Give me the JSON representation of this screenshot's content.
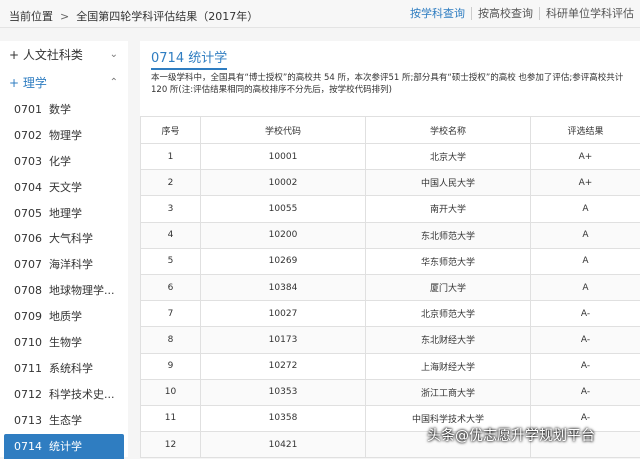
{
  "breadcrumb": {
    "current": "当前位置",
    "page": "全国第四轮学科评估结果（2017年）"
  },
  "top_links": [
    "按学科查询",
    "按高校查询",
    "科研单位学科评估"
  ],
  "sidebar": {
    "cat1": "人文社科类",
    "cat2": "理学",
    "items": [
      {
        "code": "0701",
        "name": "数学"
      },
      {
        "code": "0702",
        "name": "物理学"
      },
      {
        "code": "0703",
        "name": "化学"
      },
      {
        "code": "0704",
        "name": "天文学"
      },
      {
        "code": "0705",
        "name": "地理学"
      },
      {
        "code": "0706",
        "name": "大气科学"
      },
      {
        "code": "0707",
        "name": "海洋科学"
      },
      {
        "code": "0708",
        "name": "地球物理学..."
      },
      {
        "code": "0709",
        "name": "地质学"
      },
      {
        "code": "0710",
        "name": "生物学"
      },
      {
        "code": "0711",
        "name": "系统科学"
      },
      {
        "code": "0712",
        "name": "科学技术史..."
      },
      {
        "code": "0713",
        "name": "生态学"
      },
      {
        "code": "0714",
        "name": "统计学"
      }
    ]
  },
  "main": {
    "title": "0714 统计学",
    "description": "本一级学科中，全国具有“博士授权”的高校共 54 所，本次参评51 所;部分具有“硕士授权”的高校 也参加了评估;参评高校共计 120 所(注:评估结果相同的高校排序不分先后，按学校代码排列)",
    "columns": [
      "序号",
      "学校代码",
      "学校名称",
      "评选结果"
    ],
    "rows": [
      [
        "1",
        "10001",
        "北京大学",
        "A+"
      ],
      [
        "2",
        "10002",
        "中国人民大学",
        "A+"
      ],
      [
        "3",
        "10055",
        "南开大学",
        "A"
      ],
      [
        "4",
        "10200",
        "东北师范大学",
        "A"
      ],
      [
        "5",
        "10269",
        "华东师范大学",
        "A"
      ],
      [
        "6",
        "10384",
        "厦门大学",
        "A"
      ],
      [
        "7",
        "10027",
        "北京师范大学",
        "A-"
      ],
      [
        "8",
        "10173",
        "东北财经大学",
        "A-"
      ],
      [
        "9",
        "10272",
        "上海财经大学",
        "A-"
      ],
      [
        "10",
        "10353",
        "浙江工商大学",
        "A-"
      ],
      [
        "11",
        "10358",
        "中国科学技术大学",
        "A-"
      ],
      [
        "12",
        "10421",
        "",
        ""
      ]
    ]
  },
  "watermark": "头条@优志愿升学规划平台"
}
